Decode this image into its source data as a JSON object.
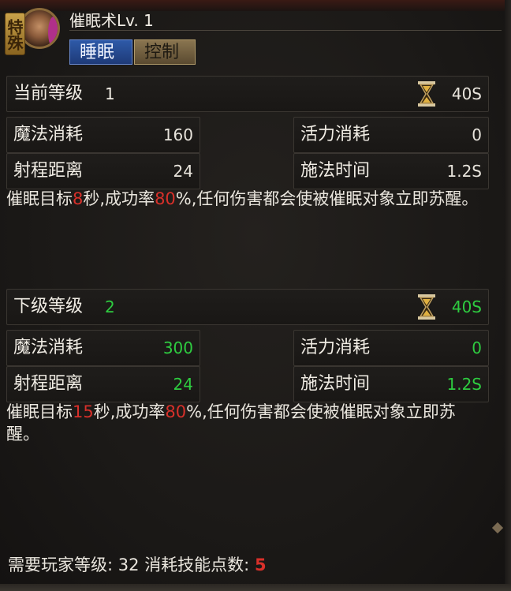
{
  "header": {
    "badge": "特殊",
    "skill_name": "催眠术Lv. 1",
    "tags": [
      "睡眠",
      "控制"
    ]
  },
  "current": {
    "level_label": "当前等级",
    "level": "1",
    "cast_value": "40S",
    "stats": [
      {
        "label": "魔法消耗",
        "value": "160"
      },
      {
        "label": "活力消耗",
        "value": "0"
      },
      {
        "label": "射程距离",
        "value": "24"
      },
      {
        "label": "施法时间",
        "value": "1.2S"
      }
    ],
    "desc_parts": [
      "催眠目标",
      "8",
      "秒,成功率",
      "80",
      "%,任何伤害都会使被催眠对象立即苏醒。"
    ]
  },
  "next": {
    "level_label": "下级等级",
    "level": "2",
    "cast_value": "40S",
    "stats": [
      {
        "label": "魔法消耗",
        "value": "300"
      },
      {
        "label": "活力消耗",
        "value": "0"
      },
      {
        "label": "射程距离",
        "value": "24"
      },
      {
        "label": "施法时间",
        "value": "1.2S"
      }
    ],
    "desc_parts": [
      "催眠目标",
      "15",
      "秒,成功率",
      "80",
      "%,任何伤害都会使被催眠对象立即苏醒。"
    ]
  },
  "requirements": {
    "player_level_label": "需要玩家等级:",
    "player_level": "32",
    "skill_points_label": "消耗技能点数:",
    "skill_points": "5"
  },
  "colors": {
    "highlight_green": "#2ecc40",
    "highlight_red": "#d8302a",
    "tag_sleep": "#2e5aa8",
    "tag_control": "#8a7550"
  }
}
